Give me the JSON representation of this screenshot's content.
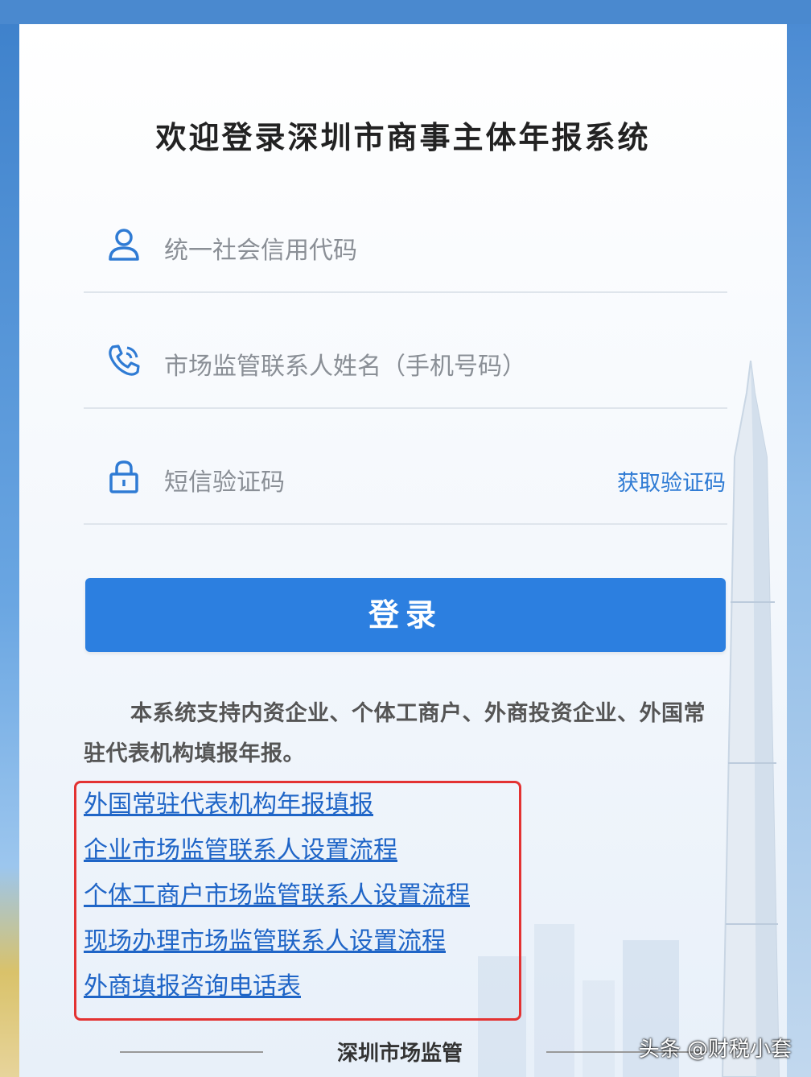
{
  "header": {
    "title": "欢迎登录深圳市商事主体年报系统"
  },
  "form": {
    "credit_code": {
      "placeholder": "统一社会信用代码",
      "icon": "user-icon"
    },
    "contact": {
      "placeholder": "市场监管联系人姓名（手机号码）",
      "icon": "phone-icon"
    },
    "sms_code": {
      "placeholder": "短信验证码",
      "icon": "lock-icon",
      "get_code_label": "获取验证码"
    },
    "login_label": "登录"
  },
  "note": "本系统支持内资企业、个体工商户、外商投资企业、外国常驻代表机构填报年报。",
  "links": [
    "外国常驻代表机构年报填报",
    "企业市场监管联系人设置流程",
    "个体工商户市场监管联系人设置流程",
    "现场办理市场监管联系人设置流程",
    "外商填报咨询电话表"
  ],
  "footer": {
    "text": "深圳市场监管"
  },
  "watermark": "头条 @财税小套",
  "colors": {
    "accent": "#2c7fe0",
    "link": "#1f65c7",
    "highlight_border": "#e33232"
  }
}
